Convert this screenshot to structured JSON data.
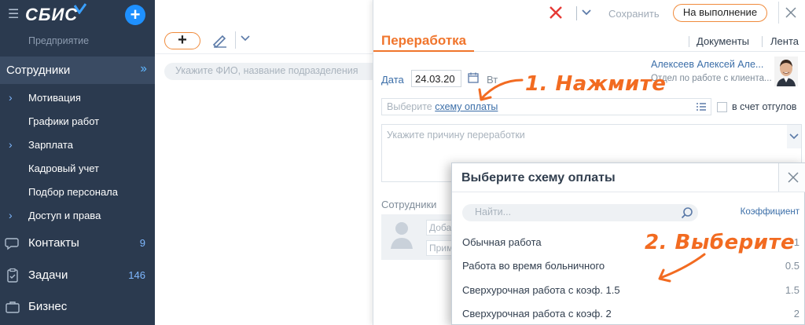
{
  "sidebar": {
    "logo": "СБИС",
    "org": "Предприятие",
    "section": "Сотрудники",
    "items": [
      {
        "label": "Мотивация",
        "arrow": true
      },
      {
        "label": "Графики работ",
        "arrow": false
      },
      {
        "label": "Зарплата",
        "arrow": true
      },
      {
        "label": "Кадровый учет",
        "arrow": false
      },
      {
        "label": "Подбор персонала",
        "arrow": false
      },
      {
        "label": "Доступ и права",
        "arrow": true
      }
    ],
    "main": [
      {
        "label": "Контакты",
        "count": "9",
        "icon": "chat-icon"
      },
      {
        "label": "Задачи",
        "count": "146",
        "icon": "clipboard-icon"
      },
      {
        "label": "Бизнес",
        "count": "",
        "icon": "briefcase-icon"
      }
    ]
  },
  "list": {
    "search_placeholder": "Укажите ФИО, название подразделения"
  },
  "panel": {
    "save_label": "Сохранить",
    "status_label": "На выполнение",
    "title": "Переработка",
    "tabs": [
      "Документы",
      "Лента"
    ],
    "date_label": "Дата",
    "date_value": "24.03.20",
    "day_value": "Вт",
    "employee_name": "Алексеев Алексей Але...",
    "employee_dept": "Отдел по работе с клиента...",
    "scheme_prefix": "Выберите ",
    "scheme_link": "схему оплаты",
    "timeoff_label": "в счет отгулов",
    "reason_placeholder": "Укажите причину переработки",
    "employees_label": "Сотрудники",
    "add_field_1": "Добав",
    "add_field_2": "Прим"
  },
  "popup": {
    "title": "Выберите схему оплаты",
    "search_placeholder": "Найти...",
    "coef_label": "Коэффициент",
    "rows": [
      {
        "name": "Обычная работа",
        "value": "1"
      },
      {
        "name": "Работа во время больничного",
        "value": "0.5"
      },
      {
        "name": "Сверхурочная работа с коэф. 1.5",
        "value": "1.5"
      },
      {
        "name": "Сверхурочная работа с коэф. 2",
        "value": "2"
      }
    ]
  },
  "annotations": {
    "step1": "1. Нажмите",
    "step2": "2. Выберите"
  },
  "colors": {
    "sidebar_bg": "#2b3a4f",
    "accent_orange": "#f0752c",
    "link_blue": "#3b6ea8",
    "close_red": "#e53935"
  }
}
